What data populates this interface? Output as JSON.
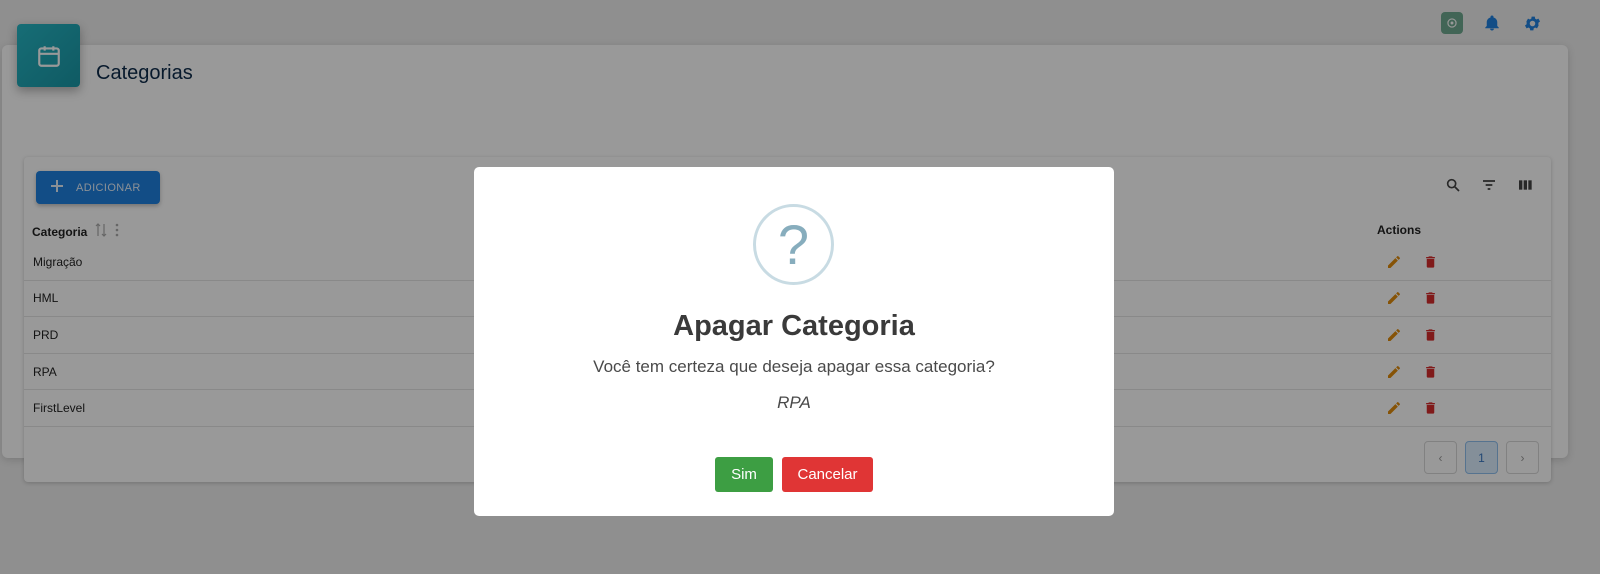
{
  "topbar": {
    "icons": [
      "openai-icon",
      "bell-icon",
      "gear-icon"
    ],
    "accent": "#1f80e0"
  },
  "page": {
    "title": "Categorias",
    "badge_icon": "calendar-icon",
    "badge_color": "#1fa9b8"
  },
  "table": {
    "add_button_label": "ADICIONAR",
    "toolbar_icons": [
      "search-icon",
      "filter-icon",
      "columns-icon"
    ],
    "columns": {
      "category": "Categoria",
      "actions": "Actions"
    },
    "rows": [
      {
        "name": "Migração"
      },
      {
        "name": "HML"
      },
      {
        "name": "PRD"
      },
      {
        "name": "RPA"
      },
      {
        "name": "FirstLevel"
      }
    ],
    "pagination": {
      "prev": "‹",
      "current_page": "1",
      "next": "›"
    }
  },
  "dialog": {
    "icon": "question-icon",
    "icon_glyph": "?",
    "title": "Apagar Categoria",
    "message": "Você tem certeza que deseja apagar essa categoria?",
    "item": "RPA",
    "confirm_label": "Sim",
    "cancel_label": "Cancelar",
    "confirm_color": "#3d9e43",
    "cancel_color": "#e03535"
  }
}
